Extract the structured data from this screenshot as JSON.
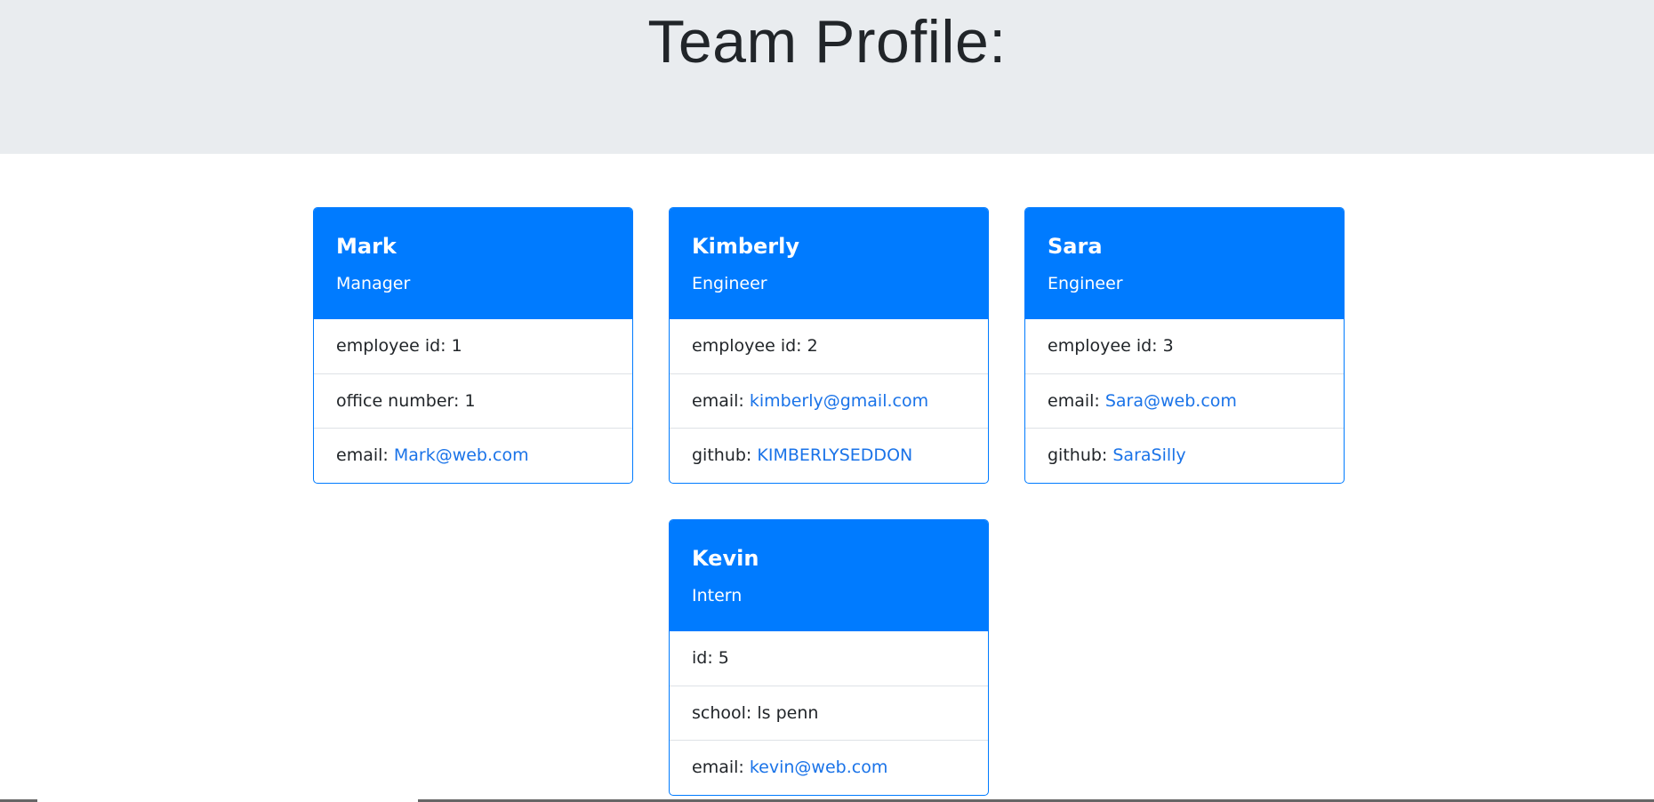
{
  "header": {
    "title": "Team Profile:"
  },
  "cards": [
    {
      "name": "Mark",
      "role": "Manager",
      "items": [
        {
          "label": "employee id: ",
          "value": "1"
        },
        {
          "label": "office number: ",
          "value": "1"
        },
        {
          "label": "email: ",
          "value": "Mark@web.com"
        }
      ]
    },
    {
      "name": "Kimberly",
      "role": "Engineer",
      "items": [
        {
          "label": "employee id: ",
          "value": "2"
        },
        {
          "label": "email: ",
          "value": "kimberly@gmail.com"
        },
        {
          "label": "github: ",
          "value": "KIMBERLYSEDDON"
        }
      ]
    },
    {
      "name": "Sara",
      "role": "Engineer",
      "items": [
        {
          "label": "employee id: ",
          "value": "3"
        },
        {
          "label": "email: ",
          "value": "Sara@web.com"
        },
        {
          "label": "github: ",
          "value": "SaraSilly"
        }
      ]
    },
    {
      "name": "Kevin",
      "role": "Intern",
      "items": [
        {
          "label": "id: ",
          "value": "5"
        },
        {
          "label": "school: ",
          "value": "ls penn"
        },
        {
          "label": "email: ",
          "value": "kevin@web.com"
        }
      ]
    }
  ],
  "colors": {
    "accent": "#007bff",
    "link": "#1a73e8",
    "jumbotron": "#e9ecef"
  }
}
